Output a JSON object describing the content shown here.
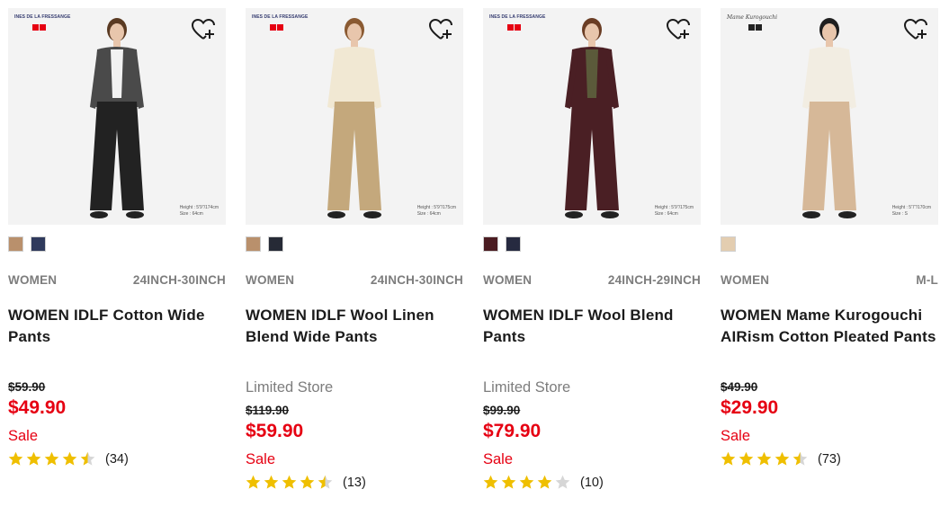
{
  "colors": {
    "accent_red": "#e60012",
    "star_gold": "#efbf00",
    "star_empty": "#d6d6d6",
    "meta_gray": "#7d7d7d"
  },
  "products": [
    {
      "brand_logo": "INES DE LA FRESSANGE",
      "model_note": "Height : 5'9\"/174cm\nSize : 64cm",
      "outfit": {
        "top": "#4a4a4a",
        "inner": "#f2f2f2",
        "pants": "#222222",
        "hair": "#5a3a22"
      },
      "swatches": [
        "#b9906c",
        "#2f3a5c"
      ],
      "gender": "WOMEN",
      "size": "24INCH-30INCH",
      "title": "WOMEN IDLF Cotton Wide Pants",
      "limited": "",
      "old_price": "$59.90",
      "price": "$49.90",
      "sale": "Sale",
      "rating": 4.5,
      "review_count": "(34)"
    },
    {
      "brand_logo": "INES DE LA FRESSANGE",
      "model_note": "Height : 5'9\"/175cm\nSize : 64cm",
      "outfit": {
        "top": "#f1e8d3",
        "inner": "#f1e8d3",
        "pants": "#c4a87c",
        "hair": "#8a5a32"
      },
      "swatches": [
        "#b9906c",
        "#262a36"
      ],
      "gender": "WOMEN",
      "size": "24INCH-30INCH",
      "title": "WOMEN IDLF Wool Linen Blend Wide Pants",
      "limited": "Limited Store",
      "old_price": "$119.90",
      "price": "$59.90",
      "sale": "Sale",
      "rating": 4.5,
      "review_count": "(13)"
    },
    {
      "brand_logo": "INES DE LA FRESSANGE",
      "model_note": "Height : 5'9\"/175cm\nSize : 64cm",
      "outfit": {
        "top": "#4a1f24",
        "inner": "#5b5a3a",
        "pants": "#4a1f24",
        "hair": "#6a3d24"
      },
      "swatches": [
        "#4b1c22",
        "#262a40"
      ],
      "gender": "WOMEN",
      "size": "24INCH-29INCH",
      "title": "WOMEN IDLF Wool Blend Pants",
      "limited": "Limited Store",
      "old_price": "$99.90",
      "price": "$79.90",
      "sale": "Sale",
      "rating": 4,
      "review_count": "(10)"
    },
    {
      "brand_logo": "Mame Kurogouchi",
      "model_note": "Height : 5'7\"/170cm\nSize : S",
      "outfit": {
        "top": "#f2ede2",
        "inner": "#f2ede2",
        "pants": "#d6b898",
        "hair": "#1f1f1f"
      },
      "swatches": [
        "#e3cdb0"
      ],
      "gender": "WOMEN",
      "size": "M-L",
      "title": "WOMEN Mame Kurogouchi AIRism Cotton Pleated Pants",
      "limited": "",
      "old_price": "$49.90",
      "price": "$29.90",
      "sale": "Sale",
      "rating": 4.5,
      "review_count": "(73)"
    }
  ]
}
